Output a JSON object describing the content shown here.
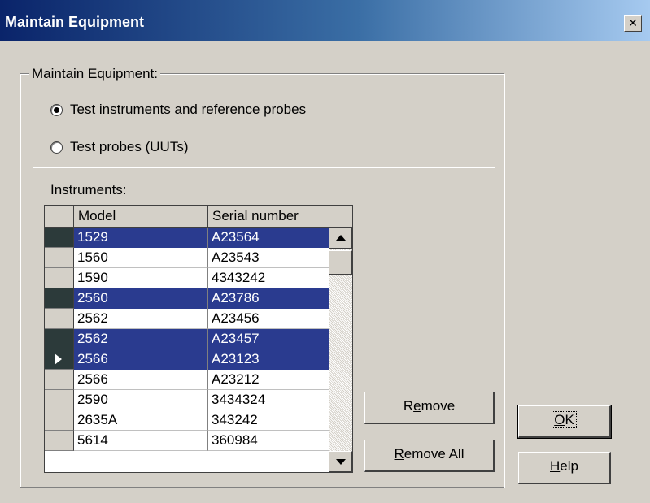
{
  "window": {
    "title": "Maintain Equipment",
    "close_glyph": "✕"
  },
  "group": {
    "title": "Maintain Equipment:",
    "options": [
      {
        "label": "Test instruments and  reference probes",
        "checked": true
      },
      {
        "label": "Test probes (UUTs)",
        "checked": false
      }
    ]
  },
  "instruments": {
    "label": "Instruments:",
    "columns": [
      "Model",
      "Serial number"
    ],
    "rows": [
      {
        "model": "1529",
        "serial": "A23564",
        "selected": true,
        "current": false
      },
      {
        "model": "1560",
        "serial": "A23543",
        "selected": false,
        "current": false
      },
      {
        "model": "1590",
        "serial": "4343242",
        "selected": false,
        "current": false
      },
      {
        "model": "2560",
        "serial": "A23786",
        "selected": true,
        "current": false
      },
      {
        "model": "2562",
        "serial": "A23456",
        "selected": false,
        "current": false
      },
      {
        "model": "2562",
        "serial": "A23457",
        "selected": true,
        "current": false
      },
      {
        "model": "2566",
        "serial": "A23123",
        "selected": true,
        "current": true
      },
      {
        "model": "2566",
        "serial": "A23212",
        "selected": false,
        "current": false
      },
      {
        "model": "2590",
        "serial": "3434324",
        "selected": false,
        "current": false
      },
      {
        "model": "2635A",
        "serial": "343242",
        "selected": false,
        "current": false
      },
      {
        "model": "5614",
        "serial": "360984",
        "selected": false,
        "current": false
      }
    ]
  },
  "buttons": {
    "remove": {
      "pre": "R",
      "mnemonic": "e",
      "post": "move"
    },
    "remove_all": {
      "pre": "",
      "mnemonic": "R",
      "post": "emove All"
    },
    "ok": {
      "pre": "",
      "mnemonic": "O",
      "post": "K"
    },
    "help": {
      "pre": "",
      "mnemonic": "H",
      "post": "elp"
    }
  },
  "colors": {
    "selection": "#2a3b8f",
    "dialog_bg": "#d4d0c8",
    "title_gradient_start": "#0a246a"
  }
}
